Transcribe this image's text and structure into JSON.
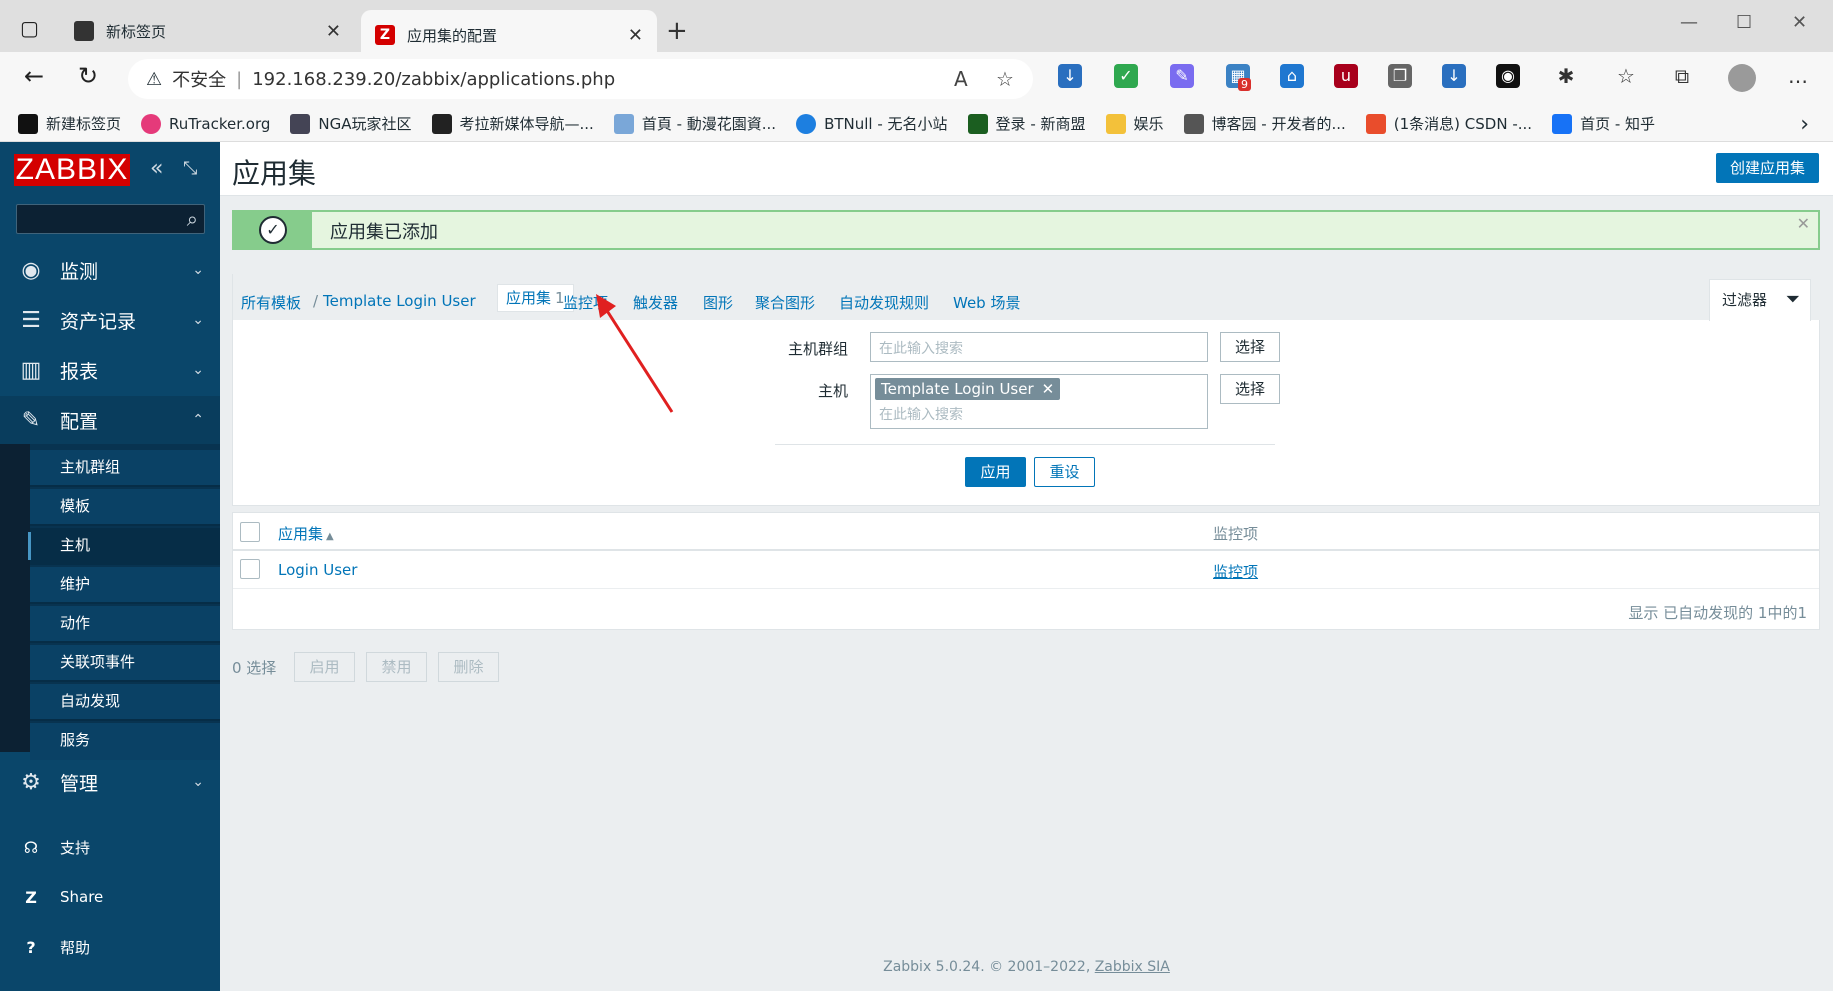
{
  "browser": {
    "tabs": [
      {
        "title": "新标签页"
      },
      {
        "title": "应用集的配置"
      }
    ],
    "address": {
      "security_label": "不安全",
      "url": "192.168.239.20/zabbix/applications.php"
    },
    "bookmarks": [
      {
        "label": "新建标签页"
      },
      {
        "label": "RuTracker.org"
      },
      {
        "label": "NGA玩家社区"
      },
      {
        "label": "考拉新媒体导航—..."
      },
      {
        "label": "首頁 - 動漫花園資..."
      },
      {
        "label": "BTNull - 无名小站"
      },
      {
        "label": "登录 - 新商盟"
      },
      {
        "label": "娱乐"
      },
      {
        "label": "博客园 - 开发者的..."
      },
      {
        "label": "(1条消息) CSDN -..."
      },
      {
        "label": "首页 - 知乎"
      }
    ],
    "extension_badge": "9"
  },
  "sidebar": {
    "logo": "ZABBIX",
    "menu": [
      {
        "label": "监测"
      },
      {
        "label": "资产记录"
      },
      {
        "label": "报表"
      },
      {
        "label": "配置"
      },
      {
        "label": "管理"
      }
    ],
    "config_submenu": [
      {
        "label": "主机群组"
      },
      {
        "label": "模板"
      },
      {
        "label": "主机"
      },
      {
        "label": "维护"
      },
      {
        "label": "动作"
      },
      {
        "label": "关联项事件"
      },
      {
        "label": "自动发现"
      },
      {
        "label": "服务"
      }
    ],
    "lower": [
      {
        "label": "支持"
      },
      {
        "label": "Share"
      },
      {
        "label": "帮助"
      }
    ]
  },
  "page": {
    "title": "应用集",
    "create_button": "创建应用集",
    "message": "应用集已添加",
    "breadcrumb": {
      "all_templates": "所有模板",
      "separator": "/",
      "template": "Template Login User"
    },
    "subtabs": {
      "current": "应用集",
      "current_count": "1",
      "items": "监控项",
      "triggers": "触发器",
      "graphs": "图形",
      "screens": "聚合图形",
      "discovery": "自动发现规则",
      "web": "Web 场景"
    },
    "filter": {
      "tab_label": "过滤器",
      "hostgroup_label": "主机群组",
      "hostgroup_placeholder": "在此输入搜索",
      "host_label": "主机",
      "host_chip": "Template Login User",
      "host_placeholder": "在此输入搜索",
      "select_button": "选择",
      "apply_button": "应用",
      "reset_button": "重设"
    },
    "table": {
      "col_application": "应用集",
      "sort_indicator": "▲",
      "col_items": "监控项",
      "rows": [
        {
          "application": "Login User",
          "items": "监控项"
        }
      ],
      "footer": "显示 已自动发现的 1中的1"
    },
    "actions": {
      "selected": "0 选择",
      "enable": "启用",
      "disable": "禁用",
      "delete": "删除"
    },
    "footer": {
      "text": "Zabbix 5.0.24. © 2001–2022, ",
      "link": "Zabbix SIA"
    }
  },
  "colors": {
    "sidebar": "#0a466a",
    "accent": "#0275b8",
    "success": "#86cc8c",
    "logo": "#d40000",
    "annotation_arrow": "#e02020"
  }
}
